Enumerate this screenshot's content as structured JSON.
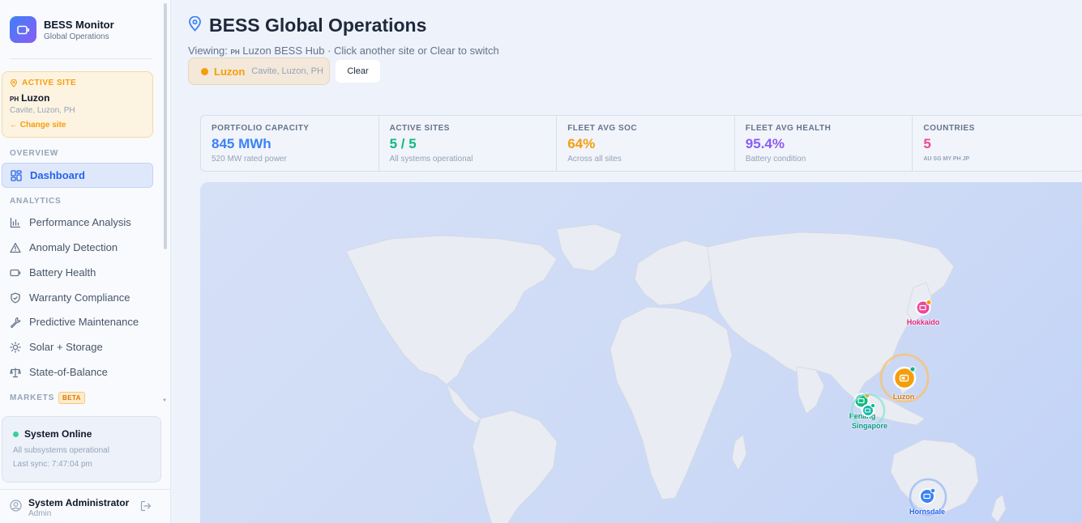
{
  "brand": {
    "title": "BESS Monitor",
    "subtitle": "Global Operations"
  },
  "active_site": {
    "label": "ACTIVE SITE",
    "flag": "PH",
    "name": "Luzon",
    "location": "Cavite, Luzon, PH",
    "change": "← Change site"
  },
  "nav": {
    "overview_label": "OVERVIEW",
    "dashboard": "Dashboard",
    "analytics_label": "ANALYTICS",
    "items": [
      "Performance Analysis",
      "Anomaly Detection",
      "Battery Health",
      "Warranty Compliance",
      "Predictive Maintenance",
      "Solar + Storage",
      "State-of-Balance"
    ],
    "markets_label": "MARKETS",
    "beta": "BETA"
  },
  "status": {
    "title": "System Online",
    "line1": "All subsystems operational",
    "line2": "Last sync: 7:47:04 pm"
  },
  "user": {
    "name": "System Administrator",
    "role": "Admin"
  },
  "header": {
    "title": "BESS Global Operations",
    "viewing_prefix": "Viewing:",
    "viewing_flag": "PH",
    "viewing_rest": "Luzon BESS Hub · Click another site or Clear to switch",
    "chip_name": "Luzon",
    "chip_location": "Cavite, Luzon, PH",
    "clear": "Clear"
  },
  "stats": [
    {
      "label": "PORTFOLIO CAPACITY",
      "value": "845 MWh",
      "sub": "520 MW rated power",
      "color": "#3b82f6"
    },
    {
      "label": "ACTIVE SITES",
      "value": "5 / 5",
      "sub": "All systems operational",
      "color": "#10b981"
    },
    {
      "label": "FLEET AVG SOC",
      "value": "64%",
      "sub": "Across all sites",
      "color": "#f59e0b"
    },
    {
      "label": "FLEET AVG HEALTH",
      "value": "95.4%",
      "sub": "Battery condition",
      "color": "#8b5cf6"
    },
    {
      "label": "COUNTRIES",
      "value": "5",
      "sub": "AU SG MY PH JP",
      "color": "#ec4899"
    }
  ],
  "map_sites": [
    {
      "name": "Hokkaido",
      "color": "#ec4899"
    },
    {
      "name": "Luzon",
      "color": "#f59e0b"
    },
    {
      "name": "Penang",
      "color": "#10b981"
    },
    {
      "name": "Singapore",
      "color": "#14b8a6"
    },
    {
      "name": "Hornsdale",
      "color": "#3b82f6"
    }
  ],
  "icons": {
    "brand": "battery-icon",
    "active_site": "map-pin-icon",
    "dashboard": "grid-icon",
    "performance": "bar-chart-icon",
    "anomaly": "warning-icon",
    "battery": "battery-icon",
    "warranty": "shield-icon",
    "maintenance": "wrench-icon",
    "solar": "sun-icon",
    "balance": "scale-icon",
    "user": "user-circle-icon",
    "logout": "logout-icon",
    "title": "map-pin-icon"
  }
}
